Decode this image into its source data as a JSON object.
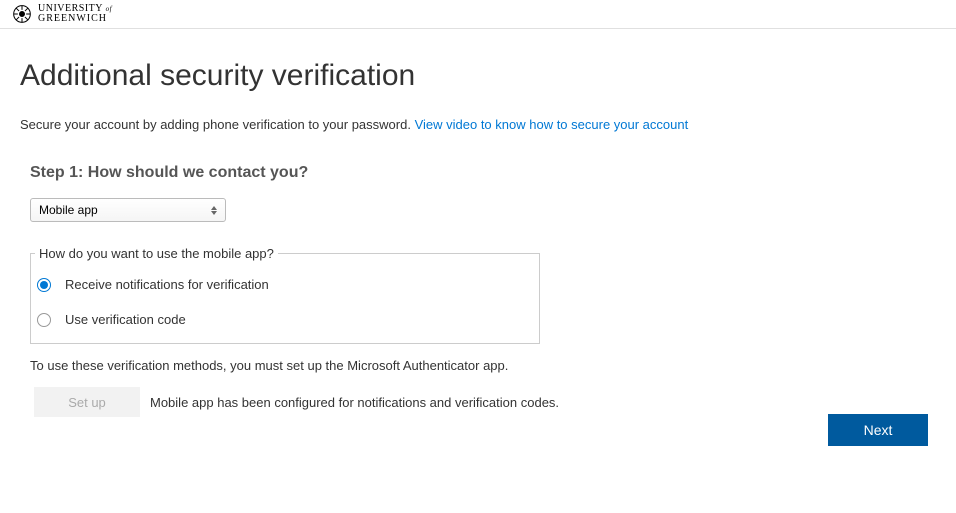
{
  "header": {
    "logo_line1": "UNIVERSITY",
    "logo_of": "of",
    "logo_line2": "GREENWICH"
  },
  "main": {
    "title": "Additional security verification",
    "subtitle_text": "Secure your account by adding phone verification to your password. ",
    "subtitle_link": "View video to know how to secure your account",
    "step_heading": "Step 1: How should we contact you?",
    "dropdown_selected": "Mobile app",
    "fieldset_legend": "How do you want to use the mobile app?",
    "radio_options": [
      {
        "label": "Receive notifications for verification",
        "selected": true
      },
      {
        "label": "Use verification code",
        "selected": false
      }
    ],
    "instruction": "To use these verification methods, you must set up the Microsoft Authenticator app.",
    "setup_button_label": "Set up",
    "setup_status": "Mobile app has been configured for notifications and verification codes.",
    "next_button_label": "Next"
  }
}
